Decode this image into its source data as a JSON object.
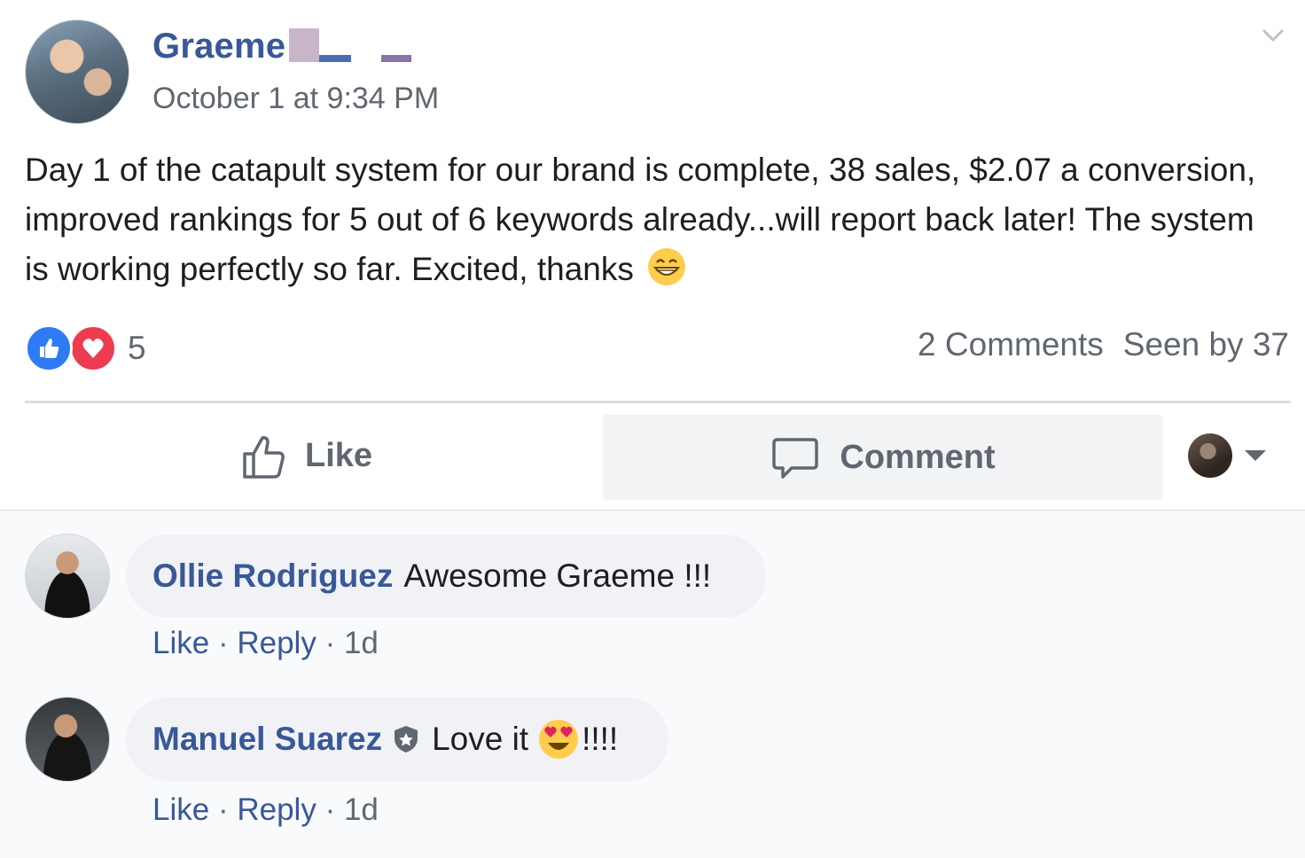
{
  "post": {
    "author": "Graeme",
    "timestamp": "October 1 at 9:34 PM",
    "text": "Day 1 of the catapult system for our brand is complete, 38 sales, $2.07 a conversion, improved rankings for 5 out of 6 keywords already...will report back later! The system is working perfectly so far. Excited, thanks",
    "emoji": "grinning-face-emoji"
  },
  "reactions": {
    "types": [
      "like",
      "love"
    ],
    "count": "5",
    "colors": {
      "like": "#2e7bf5",
      "love": "#ef3b4f"
    }
  },
  "stats": {
    "comments": "2 Comments",
    "seen": "Seen by 37"
  },
  "actions": {
    "like_label": "Like",
    "comment_label": "Comment"
  },
  "comments": [
    {
      "name": "Ollie Rodriguez",
      "text": "Awesome Graeme !!!",
      "like": "Like",
      "reply": "Reply",
      "sep": "·",
      "age": "1d"
    },
    {
      "name": "Manuel Suarez",
      "badge": "shield-icon",
      "text_before": "Love it",
      "text_after": "!!!!",
      "like": "Like",
      "reply": "Reply",
      "sep": "·",
      "age": "1d"
    }
  ],
  "colors": {
    "link": "#385898",
    "secondary_text": "#606770",
    "bubble": "#f0f2f5"
  }
}
